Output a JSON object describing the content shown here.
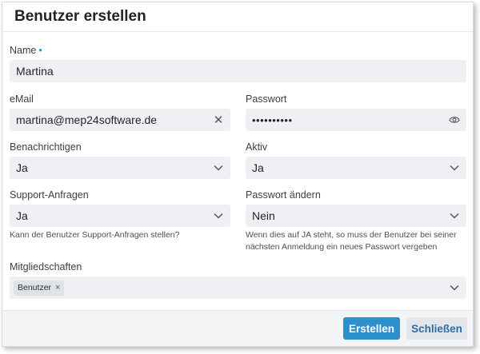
{
  "dialog": {
    "title": "Benutzer erstellen"
  },
  "form": {
    "name": {
      "label": "Name",
      "required_marker": "•",
      "value": "Martina"
    },
    "email": {
      "label": "eMail",
      "value": "martina@mep24software.de",
      "clear_icon": "close-icon"
    },
    "password": {
      "label": "Passwort",
      "value": "••••••••••",
      "toggle_icon": "eye-icon"
    },
    "benachrichtigen": {
      "label": "Benachrichtigen",
      "value": "Ja"
    },
    "aktiv": {
      "label": "Aktiv",
      "value": "Ja"
    },
    "support": {
      "label": "Support-Anfragen",
      "value": "Ja",
      "hint": "Kann der Benutzer Support-Anfragen stellen?"
    },
    "passwort_aendern": {
      "label": "Passwort ändern",
      "value": "Nein",
      "hint_line1": "Wenn dies auf JA steht, so muss der Benutzer bei seiner",
      "hint_line2": "nächsten Anmeldung ein neues Passwort vergeben"
    },
    "mitgliedschaften": {
      "label": "Mitgliedschaften",
      "tags": [
        {
          "label": "Benutzer",
          "remove": "×"
        }
      ]
    }
  },
  "footer": {
    "create_label": "Erstellen",
    "close_label": "Schließen"
  },
  "colors": {
    "primary": "#2e8fcf",
    "required": "#2b8fd6",
    "input_bg": "#eef0f3"
  }
}
